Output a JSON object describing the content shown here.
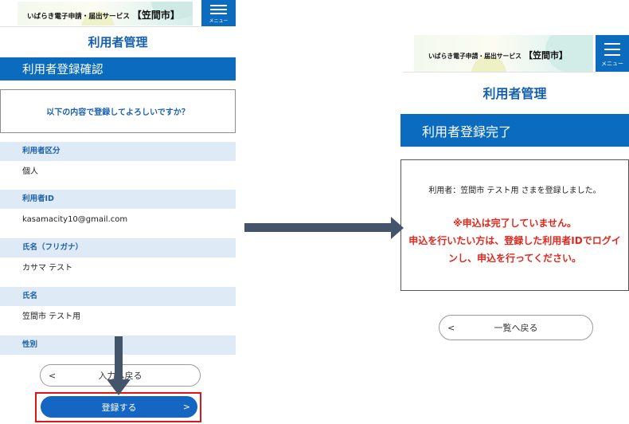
{
  "colors": {
    "primary": "#0b6cbf",
    "title": "#1460ad",
    "label_band": "#deebf7",
    "label_text": "#1a5fa8",
    "warning": "#e0281e",
    "highlight": "#e3121b",
    "arrow": "#44546a",
    "button": "#1466c2"
  },
  "left": {
    "header": {
      "logo_text": "いばらき電子申請・届出サービス",
      "logo_city": "【笠間市】",
      "menu_label": "メニュー",
      "menu_icon": "hamburger-icon"
    },
    "page_title": "利用者管理",
    "section_title": "利用者登録確認",
    "confirm_message": "以下の内容で登録してよろしいですか？",
    "fields": [
      {
        "label": "利用者区分",
        "value": "個人"
      },
      {
        "label": "利用者ID",
        "value": "kasamacity10@gmail.com"
      },
      {
        "label": "氏名（フリガナ）",
        "value": "カサマ テスト"
      },
      {
        "label": "氏名",
        "value": "笠間市 テスト用"
      },
      {
        "label": "性別"
      }
    ],
    "back_button": {
      "chevron": "<",
      "label": "入力へ戻る"
    },
    "submit_button": {
      "label": "登録する",
      "chevron": ">"
    }
  },
  "right": {
    "header": {
      "logo_text": "いばらき電子申請・届出サービス",
      "logo_city": "【笠間市】",
      "menu_label": "メニュー",
      "menu_icon": "hamburger-icon"
    },
    "page_title": "利用者管理",
    "section_title": "利用者登録完了",
    "message": "利用者：笠間市 テスト用 さまを登録しました。",
    "warning_lines": [
      "※申込は完了していません。",
      "申込を行いたい方は、登録した利用者IDでログイ",
      "ンし、申込を行ってください。"
    ],
    "back_button": {
      "chevron": "<",
      "label": "一覧へ戻る"
    }
  },
  "annotations": {
    "down_arrow": "arrow-down-icon",
    "flow_arrow": "arrow-right-icon"
  }
}
